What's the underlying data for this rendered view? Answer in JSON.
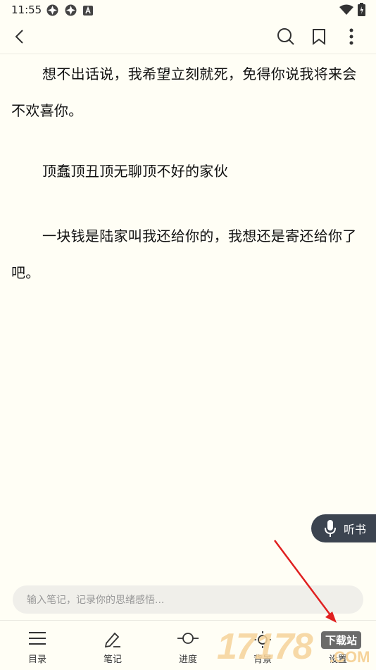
{
  "status": {
    "time": "11:55"
  },
  "toolbar": {
    "back_icon": "chevron-left-icon",
    "search_icon": "search-icon",
    "bookmark_icon": "bookmark-icon",
    "more_icon": "more-vertical-icon"
  },
  "content": {
    "paragraphs": [
      "想不出话说，我希望立刻就死，免得你说我将来会不欢喜你。",
      "顶蠢顶丑顶无聊顶不好的家伙",
      "一块钱是陆家叫我还给你的，我想还是寄还给你了吧。"
    ]
  },
  "listen": {
    "label": "听书",
    "icon": "microphone-icon"
  },
  "note": {
    "placeholder": "输入笔记，记录你的思绪感悟..."
  },
  "nav": {
    "items": [
      {
        "label": "目录",
        "icon": "list-icon"
      },
      {
        "label": "笔记",
        "icon": "pencil-icon"
      },
      {
        "label": "进度",
        "icon": "progress-icon"
      },
      {
        "label": "背景",
        "icon": "brightness-icon"
      },
      {
        "label": "设置",
        "icon": "settings-icon"
      }
    ]
  },
  "watermark": {
    "number": "17178",
    "site": "下载站",
    "domain": ".COM"
  },
  "colors": {
    "background": "#fffef5",
    "listen_bg": "#3c4450",
    "arrow": "#e02020",
    "watermark": "#f6d39a"
  }
}
